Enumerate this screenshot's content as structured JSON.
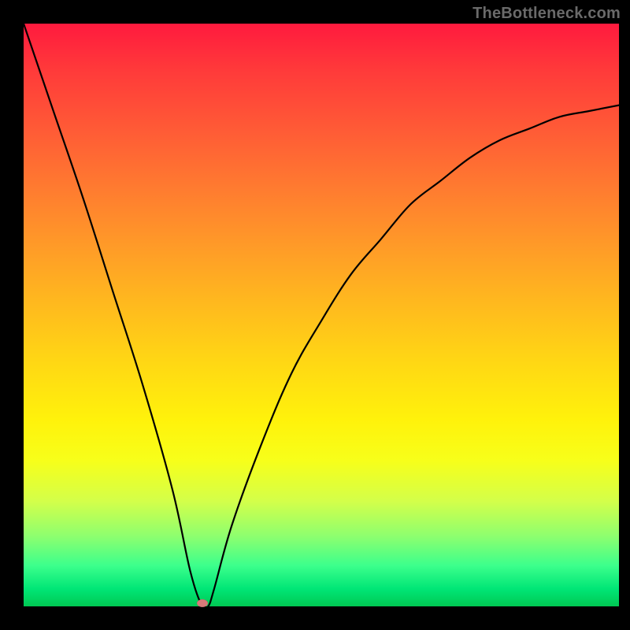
{
  "watermark": "TheBottleneck.com",
  "colors": {
    "frame": "#000000",
    "curve": "#000000",
    "dot": "#d97a7a"
  },
  "chart_data": {
    "type": "line",
    "title": "",
    "xlabel": "",
    "ylabel": "",
    "xlim": [
      0,
      100
    ],
    "ylim": [
      0,
      100
    ],
    "annotations": [
      "TheBottleneck.com"
    ],
    "grid": false,
    "series": [
      {
        "name": "bottleneck-curve",
        "x": [
          0,
          5,
          10,
          15,
          20,
          25,
          28,
          30,
          31,
          32,
          35,
          40,
          45,
          50,
          55,
          60,
          65,
          70,
          75,
          80,
          85,
          90,
          95,
          100
        ],
        "values": [
          100,
          85,
          70,
          54,
          38,
          20,
          6,
          0,
          0,
          3,
          14,
          28,
          40,
          49,
          57,
          63,
          69,
          73,
          77,
          80,
          82,
          84,
          85,
          86
        ]
      }
    ],
    "marker": {
      "x": 30,
      "y": 0,
      "name": "minimum-point"
    },
    "background_gradient": {
      "direction": "top-to-bottom",
      "stops": [
        "red",
        "orange",
        "yellow",
        "green"
      ]
    }
  }
}
